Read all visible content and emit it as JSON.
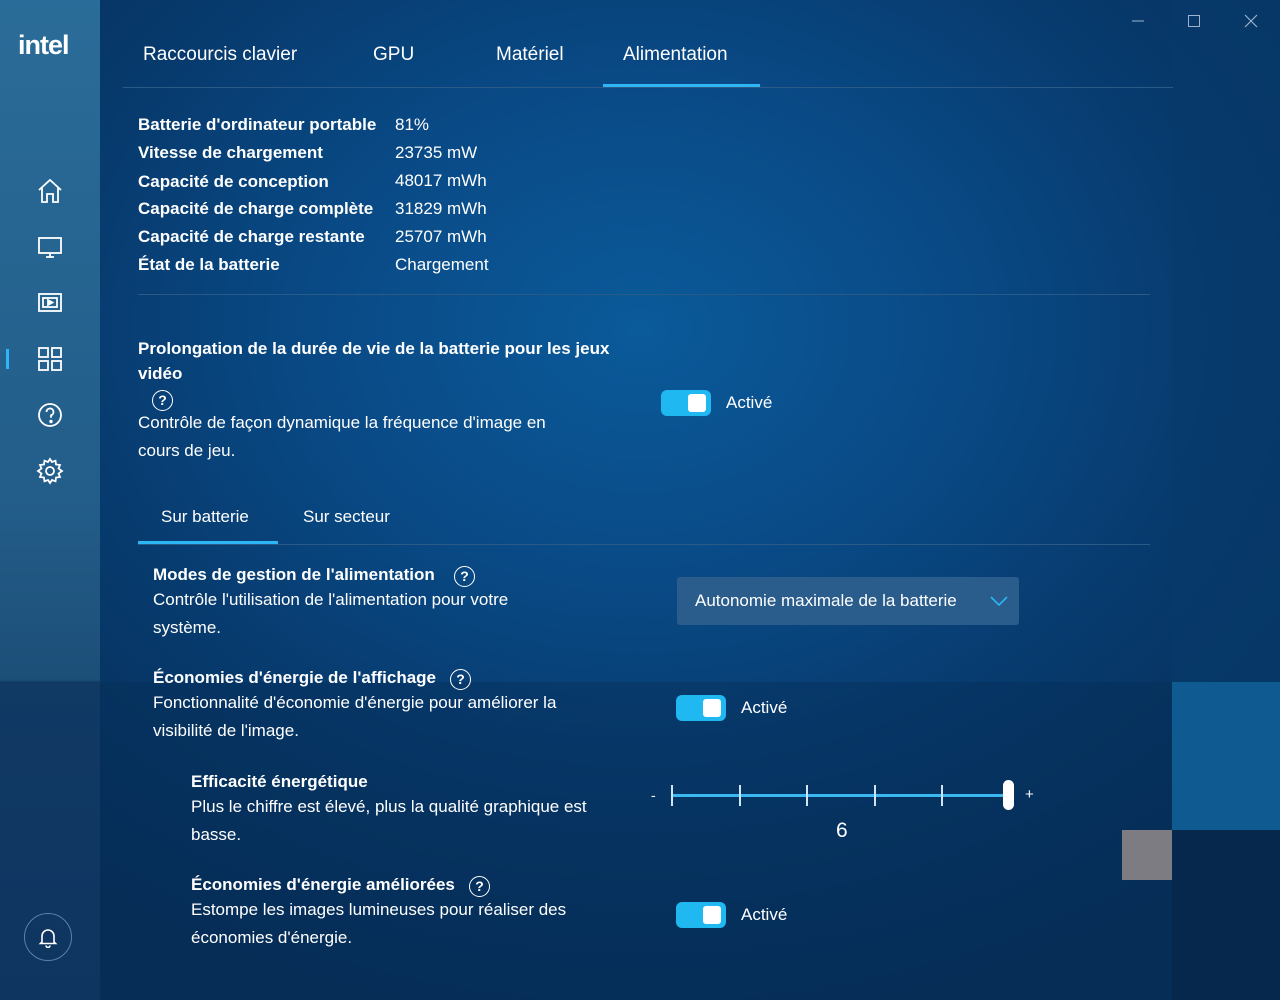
{
  "app": {
    "brand": "intel"
  },
  "window_controls": {
    "minimize_icon": "minimize-icon",
    "maximize_icon": "maximize-icon",
    "close_icon": "close-icon"
  },
  "sidebar": {
    "items": [
      {
        "icon": "home-icon"
      },
      {
        "icon": "display-icon"
      },
      {
        "icon": "video-icon"
      },
      {
        "icon": "apps-grid-icon",
        "active": true
      },
      {
        "icon": "help-icon"
      },
      {
        "icon": "gear-icon"
      }
    ],
    "notification_icon": "bell-icon"
  },
  "tabs": [
    {
      "label": "Raccourcis clavier"
    },
    {
      "label": "GPU"
    },
    {
      "label": "Matériel"
    },
    {
      "label": "Alimentation",
      "active": true
    }
  ],
  "battery_info": [
    {
      "label": "Batterie d'ordinateur portable",
      "value": "81%"
    },
    {
      "label": "Vitesse de chargement",
      "value": "23735 mW"
    },
    {
      "label": "Capacité de conception",
      "value": "48017 mWh"
    },
    {
      "label": "Capacité de charge complète",
      "value": "31829 mWh"
    },
    {
      "label": "Capacité de charge restante",
      "value": "25707 mWh"
    },
    {
      "label": "État de la batterie",
      "value": "Chargement"
    }
  ],
  "game_battery": {
    "title_line1": "Prolongation de la durée de vie de la batterie pour les jeux",
    "title_line2": "vidéo",
    "help": "?",
    "desc_line1": "Contrôle de façon dynamique la fréquence d'image en",
    "desc_line2": "cours de jeu.",
    "toggle_label": "Activé",
    "enabled": true
  },
  "subtabs": [
    {
      "label": "Sur batterie",
      "active": true
    },
    {
      "label": "Sur secteur"
    }
  ],
  "power_modes": {
    "title": "Modes de gestion de l'alimentation",
    "help": "?",
    "desc_line1": "Contrôle l'utilisation de l'alimentation pour votre",
    "desc_line2": "système.",
    "selected": "Autonomie maximale de la batterie"
  },
  "display_savings": {
    "title": "Économies d'énergie de l'affichage",
    "help": "?",
    "desc_line1": "Fonctionnalité d'économie d'énergie pour améliorer la",
    "desc_line2": "visibilité de l'image.",
    "toggle_label": "Activé",
    "enabled": true
  },
  "efficiency": {
    "title": "Efficacité énergétique",
    "desc_line1": "Plus le chiffre est élevé, plus la qualité graphique est",
    "desc_line2": "basse.",
    "min_label": "-",
    "max_label": "+",
    "value": "6",
    "min": 1,
    "max": 6
  },
  "enhanced_savings": {
    "title": "Économies d'énergie améliorées",
    "help": "?",
    "desc_line1": "Estompe les images lumineuses pour réaliser des",
    "desc_line2": "économies d'énergie.",
    "toggle_label": "Activé",
    "enabled": true
  },
  "colors": {
    "accent": "#1fb8f0"
  }
}
